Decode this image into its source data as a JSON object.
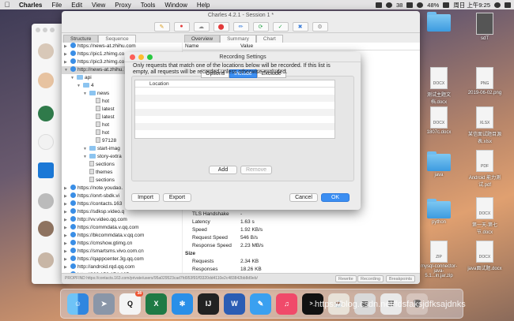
{
  "menubar": {
    "app": "Charles",
    "items": [
      "File",
      "Edit",
      "View",
      "Proxy",
      "Tools",
      "Window",
      "Help"
    ],
    "battery": "48%",
    "clock": "周日 上午9:25",
    "badge_count": "38"
  },
  "charles": {
    "title": "Charles 4.2.1 - Session 1 *",
    "tabs_left": [
      "Structure",
      "Sequence"
    ],
    "tabs_right": [
      "Overview",
      "Summary",
      "Chart"
    ],
    "detail_header": {
      "name": "Name",
      "value": "Value"
    },
    "tree_rows": [
      {
        "label": "https://news-at.zhihu.com",
        "kind": "host",
        "indent": 0
      },
      {
        "label": "https://pic1.zhimg.co",
        "kind": "host",
        "indent": 0
      },
      {
        "label": "https://pic3.zhimg.co",
        "kind": "host",
        "indent": 0
      },
      {
        "label": "http://news-at.zhihu.",
        "kind": "host",
        "indent": 0,
        "selected": true
      },
      {
        "label": "api",
        "kind": "folder",
        "indent": 1
      },
      {
        "label": "4",
        "kind": "folder",
        "indent": 2
      },
      {
        "label": "news",
        "kind": "folder",
        "indent": 3
      },
      {
        "label": "hot",
        "kind": "file",
        "indent": 4
      },
      {
        "label": "latest",
        "kind": "file",
        "indent": 4
      },
      {
        "label": "latest",
        "kind": "file",
        "indent": 4
      },
      {
        "label": "hot",
        "kind": "file",
        "indent": 4
      },
      {
        "label": "hot",
        "kind": "file",
        "indent": 4
      },
      {
        "label": "97128",
        "kind": "file",
        "indent": 4
      },
      {
        "label": "start-imag",
        "kind": "folder",
        "indent": 3
      },
      {
        "label": "story-extra",
        "kind": "folder",
        "indent": 3
      },
      {
        "label": "sections",
        "kind": "file",
        "indent": 3
      },
      {
        "label": "themes",
        "kind": "file",
        "indent": 3
      },
      {
        "label": "sections",
        "kind": "file",
        "indent": 3
      },
      {
        "label": "https://note.youdao.",
        "kind": "host",
        "indent": 0
      },
      {
        "label": "https://onrt-sbdk.vi",
        "kind": "host",
        "indent": 0
      },
      {
        "label": "https://contacts.163",
        "kind": "host",
        "indent": 0
      },
      {
        "label": "https://sdksp.video.q",
        "kind": "host",
        "indent": 0
      },
      {
        "label": "http://vv.video.qq.com",
        "kind": "host",
        "indent": 0
      },
      {
        "label": "https://commdata.v.qq.com",
        "kind": "host",
        "indent": 0
      },
      {
        "label": "https://bkcommdata.v.qq.com",
        "kind": "host",
        "indent": 0
      },
      {
        "label": "https://cmshow.gtimg.cn",
        "kind": "host",
        "indent": 0
      },
      {
        "label": "https://smartsms.vivo.com.cn",
        "kind": "host",
        "indent": 0
      },
      {
        "label": "https://qappcenter.3g.qq.com",
        "kind": "host",
        "indent": 0
      },
      {
        "label": "http://android.rqd.qq.com",
        "kind": "host",
        "indent": 0
      },
      {
        "label": "http://223.150.174.165",
        "kind": "host",
        "indent": 0
      }
    ],
    "detail_rows": [
      {
        "name": "TLS Handshake",
        "value": "-",
        "section": false
      },
      {
        "name": "Latency",
        "value": "1.63 s",
        "section": false
      },
      {
        "name": "Speed",
        "value": "1.92 KB/s",
        "section": false
      },
      {
        "name": "Request Speed",
        "value": "546 B/s",
        "section": false
      },
      {
        "name": "Response Speed",
        "value": "2.23 MB/s",
        "section": false
      },
      {
        "name": "Size",
        "value": "",
        "section": true
      },
      {
        "name": "Requests",
        "value": "2.34 KB",
        "section": false
      },
      {
        "name": "Responses",
        "value": "18.26 KB",
        "section": false
      }
    ],
    "status_text": "PROPFIND https://contacts.163.com/private/users/95a029523cad7fd953f91ff3320dd4110e2c483842bb8d9eb/",
    "status_buttons": [
      "Rewrite",
      "Recording",
      "Breakpoints"
    ]
  },
  "dialog": {
    "title": "Recording Settings",
    "tabs": [
      "Options",
      "Include",
      "Exclude"
    ],
    "active_tab": "Include",
    "description": "Only requests that match one of the locations below will be recorded. If this list is empty, all requests will be recorded unless otherwise excluded.",
    "column_header": "Location",
    "add_label": "Add",
    "remove_label": "Remove",
    "import_label": "Import",
    "export_label": "Export",
    "cancel_label": "Cancel",
    "ok_label": "OK"
  },
  "desktop_icons": [
    {
      "label": "",
      "kind": "folder"
    },
    {
      "label": "sdT",
      "kind": "doc"
    },
    {
      "label": "测试主题文档.docx",
      "kind": "doc"
    },
    {
      "label": "2019-06-02.png",
      "kind": "doc"
    },
    {
      "label": "1807c.docx",
      "kind": "doc"
    },
    {
      "label": "某信面试题目源表.xlsx",
      "kind": "doc"
    },
    {
      "label": "java",
      "kind": "folder"
    },
    {
      "label": "Android 能力测试.pdf",
      "kind": "doc"
    },
    {
      "label": "python",
      "kind": "folder"
    },
    {
      "label": "第一天-第七节.docx",
      "kind": "doc"
    },
    {
      "label": "mysql-connector-java-5.1...in.jar.zip",
      "kind": "doc"
    },
    {
      "label": "java面试题.docx",
      "kind": "doc"
    }
  ],
  "dock": {
    "badge": "38",
    "watermark": "https://blog.csdn.net/fdsfaksjdfksajdnks"
  }
}
